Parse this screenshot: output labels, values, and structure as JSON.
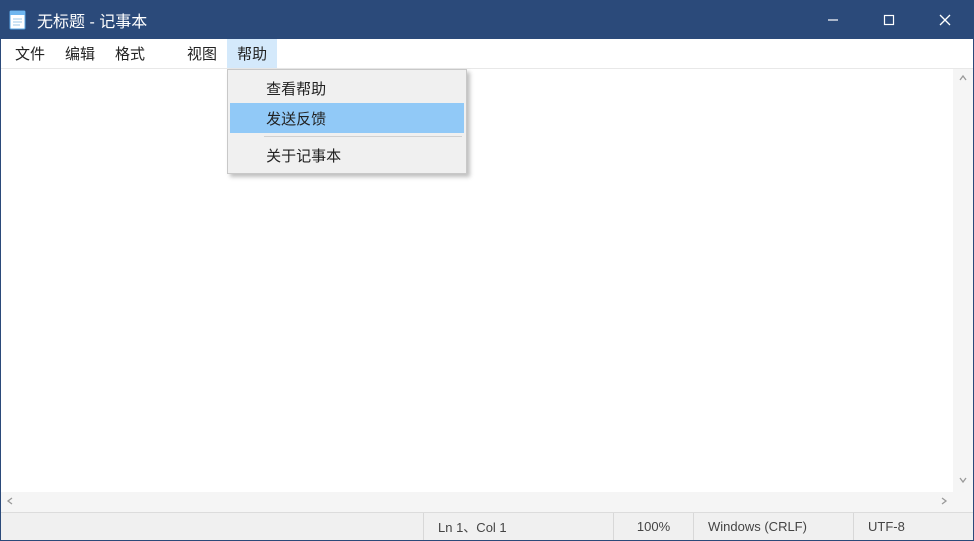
{
  "titlebar": {
    "title": "无标题 - 记事本"
  },
  "menubar": {
    "file": "文件",
    "edit": "编辑",
    "format": "格式",
    "view": "视图",
    "help": "帮助"
  },
  "help_menu": {
    "view_help": "查看帮助",
    "send_feedback": "发送反馈",
    "about": "关于记事本"
  },
  "statusbar": {
    "position": "Ln 1、Col 1",
    "zoom": "100%",
    "eol": "Windows (CRLF)",
    "encoding": "UTF-8"
  }
}
